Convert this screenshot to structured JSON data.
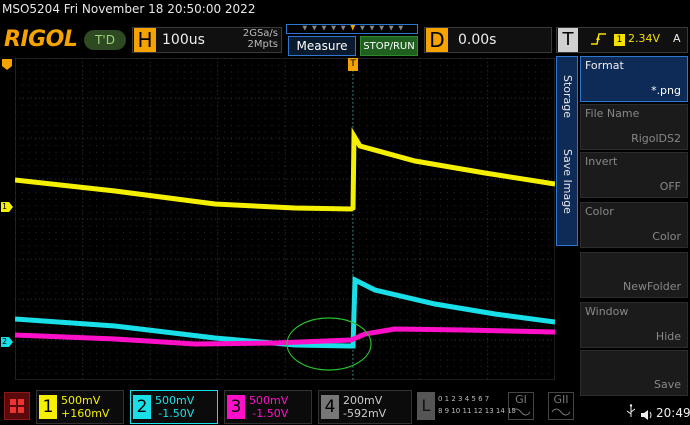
{
  "header": {
    "model_datetime": "MSO5204  Fri November 18 20:50:00 2022",
    "logo": "RIGOL",
    "trigger_status": "T'D",
    "horizontal": {
      "letter": "H",
      "timebase": "100us",
      "sample_rate": "2GSa/s",
      "memory_depth": "2Mpts"
    },
    "measure_label": "Measure",
    "stop_run_label": "STOP/RUN",
    "delay": {
      "letter": "D",
      "value": "0.00s"
    },
    "trigger": {
      "letter": "T",
      "edge_icon": "rising-edge-icon",
      "source": "1",
      "level": "2.34V",
      "mode": "A"
    }
  },
  "side_menu": {
    "tabs": [
      "Storage",
      "Save Image"
    ],
    "items": [
      {
        "label": "Format",
        "value": "*.png",
        "enabled": true
      },
      {
        "label": "File Name",
        "value": "RigolDS2",
        "enabled": false
      },
      {
        "label": "Invert",
        "value": "OFF",
        "enabled": false
      },
      {
        "label": "Color",
        "value": "Color",
        "enabled": false
      },
      {
        "label": "",
        "value": "NewFolder",
        "enabled": false
      },
      {
        "label": "Window",
        "value": "Hide",
        "enabled": false
      },
      {
        "label": "",
        "value": "Save",
        "enabled": false
      }
    ]
  },
  "waveform": {
    "ch1_marker": "1",
    "ch2_marker": "2",
    "trigger_marker": "T",
    "colors": {
      "ch1": "#f5f000",
      "ch2": "#19e0e8",
      "ch3": "#ff10c8",
      "highlight": "#28c028"
    }
  },
  "channels": [
    {
      "num": "1",
      "scale": "500mV",
      "offset": "+160mV",
      "color": "#f5f000"
    },
    {
      "num": "2",
      "scale": "500mV",
      "offset": "-1.50V",
      "color": "#19e0e8"
    },
    {
      "num": "3",
      "scale": "500mV",
      "offset": "-1.50V",
      "color": "#ff10c8"
    },
    {
      "num": "4",
      "scale": "200mV",
      "offset": "-592mV",
      "color": "#cccccc"
    }
  ],
  "logic": {
    "letter": "L",
    "row1": "0 1 2 3 4 5 6 7",
    "row2": "8 9 10 11 12 13 14 15"
  },
  "generators": [
    "GI",
    "GII"
  ],
  "status": {
    "time": "20:49",
    "usb_icon": "usb-icon"
  }
}
